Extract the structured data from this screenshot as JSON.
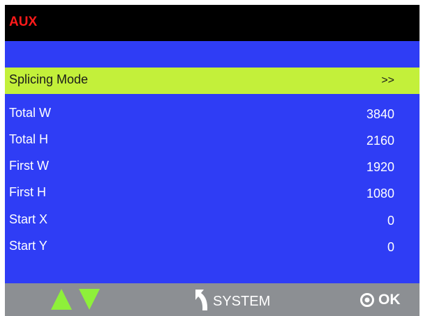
{
  "header": {
    "title": "AUX"
  },
  "menu": {
    "items": [
      {
        "label": "Splicing Mode",
        "value": ">>",
        "selected": true
      },
      {
        "label": "Total W",
        "value": "3840"
      },
      {
        "label": "Total H",
        "value": "2160"
      },
      {
        "label": "First W",
        "value": "1920"
      },
      {
        "label": "First H",
        "value": "1080"
      },
      {
        "label": "Start X",
        "value": "0"
      },
      {
        "label": "Start Y",
        "value": "0"
      }
    ]
  },
  "footer": {
    "nav_up_icon": "arrow-up-icon",
    "nav_down_icon": "arrow-down-icon",
    "back_icon": "return-arrow-icon",
    "back_label": "SYSTEM",
    "ok_icon": "ring-icon",
    "ok_label": "OK"
  },
  "colors": {
    "background": "#2f3df5",
    "title_bar": "#000000",
    "title_text": "#ff1a1a",
    "selected_row": "#c3f03a",
    "footer": "#8c8f93",
    "arrow": "#8ef03a"
  }
}
